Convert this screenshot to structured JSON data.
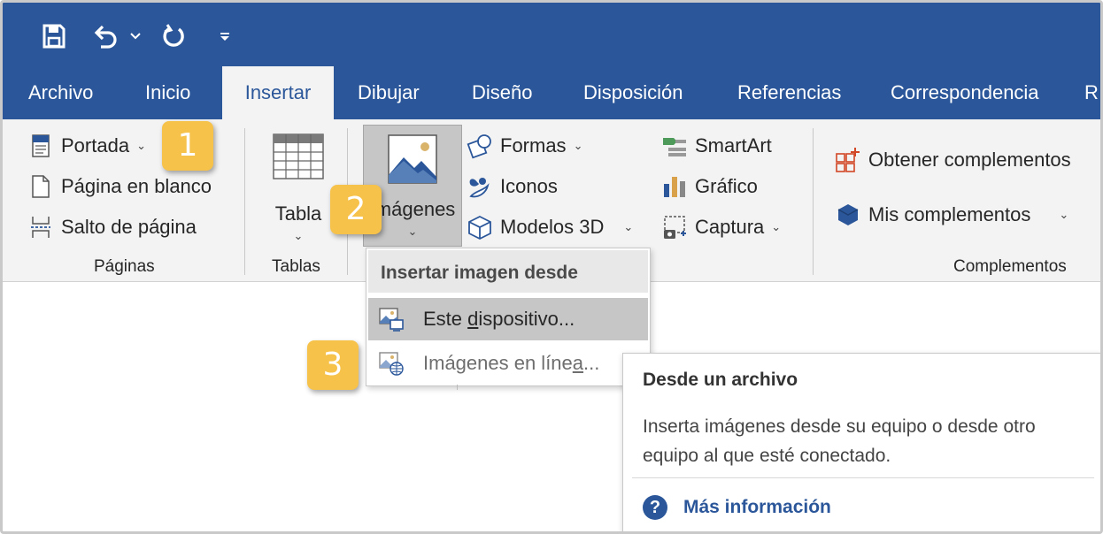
{
  "quick_access": {
    "save": "save-icon",
    "undo": "undo-icon",
    "redo": "repeat-icon",
    "customize": "customize-icon"
  },
  "tabs": [
    "Archivo",
    "Inicio",
    "Insertar",
    "Dibujar",
    "Diseño",
    "Disposición",
    "Referencias",
    "Correspondencia",
    "R"
  ],
  "active_tab": "Insertar",
  "groups": {
    "paginas": {
      "label": "Páginas",
      "portada": "Portada",
      "pagina_blanco": "Página en blanco",
      "salto_pagina": "Salto de página"
    },
    "tablas": {
      "label": "Tablas",
      "tabla": "Tabla"
    },
    "ilustraciones": {
      "imagenes": "Imágenes",
      "formas": "Formas",
      "iconos": "Iconos",
      "modelos3d": "Modelos 3D",
      "smartart": "SmartArt",
      "grafico": "Gráfico",
      "captura": "Captura"
    },
    "complementos": {
      "label": "Complementos",
      "obtener": "Obtener complementos",
      "mis": "Mis complementos"
    }
  },
  "badges": [
    "1",
    "2",
    "3"
  ],
  "dropdown": {
    "header": "Insertar imagen desde",
    "item1_pre": "Este ",
    "item1_u": "d",
    "item1_post": "ispositivo...",
    "item2_pre": "Imágenes en líne",
    "item2_u": "a",
    "item2_post": "..."
  },
  "tooltip": {
    "title": "Desde un archivo",
    "body": "Inserta imágenes desde su equipo o desde otro equipo al que esté conectado.",
    "more": "Más información"
  },
  "colors": {
    "brand": "#2b579a",
    "ribbon_bg": "#f3f3f3",
    "badge": "#f6c24a",
    "addin_red": "#d24726"
  }
}
